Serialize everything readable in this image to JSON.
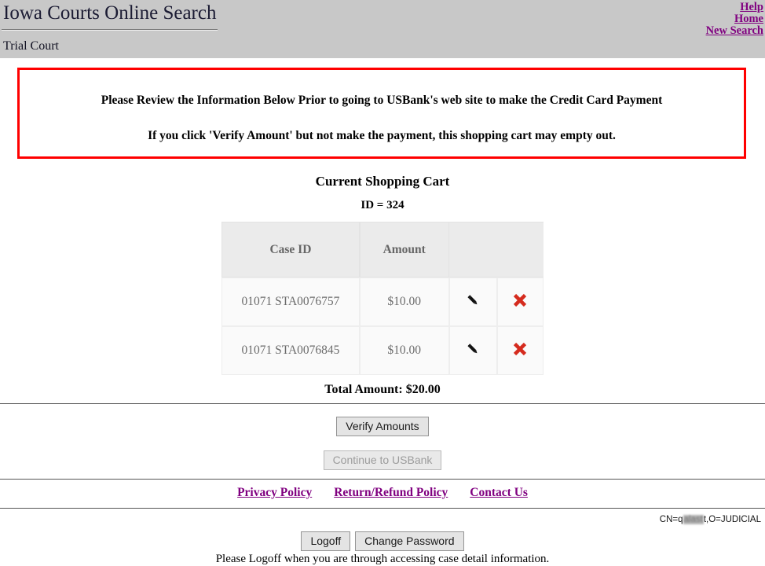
{
  "header": {
    "site_title": "Iowa Courts Online Search",
    "sub_title": "Trial Court",
    "links": [
      {
        "label": "Help"
      },
      {
        "label": "Home"
      },
      {
        "label": "New Search"
      }
    ]
  },
  "warning": {
    "line1": "Please Review the Information Below Prior to going to USBank's web site to make the Credit Card Payment",
    "line2": "If you click 'Verify Amount' but not make the payment, this shopping cart may empty out.",
    "border_color": "#ff0000"
  },
  "cart": {
    "heading": "Current Shopping Cart",
    "id_label": "ID = 324",
    "columns": [
      "Case ID",
      "Amount",
      "",
      ""
    ],
    "rows": [
      {
        "case_id": "01071 STA0076757",
        "amount": "$10.00",
        "edit_icon": "pencil-icon",
        "delete_icon": "red-x-icon"
      },
      {
        "case_id": "01071 STA0076845",
        "amount": "$10.00",
        "edit_icon": "pencil-icon",
        "delete_icon": "red-x-icon"
      }
    ],
    "total": "Total Amount: $20.00"
  },
  "actions": {
    "verify_label": "Verify Amounts",
    "usbank_label": "Continue to USBank",
    "usbank_disabled": true
  },
  "footer": {
    "policy_links": [
      {
        "label": "Privacy Policy"
      },
      {
        "label": "Return/Refund Policy"
      },
      {
        "label": "Contact Us"
      }
    ],
    "cert_prefix": "CN=q",
    "cert_redacted": "alast",
    "cert_suffix": "t,O=JUDICIAL",
    "logoff_label": "Logoff",
    "change_password_label": "Change Password",
    "logoff_note": "Please Logoff when you are through accessing case detail information."
  },
  "colors": {
    "header_bg": "#c8c8c8",
    "link_purple": "#800080",
    "warn_red": "#ff0000",
    "delete_red": "#d52b1e"
  }
}
